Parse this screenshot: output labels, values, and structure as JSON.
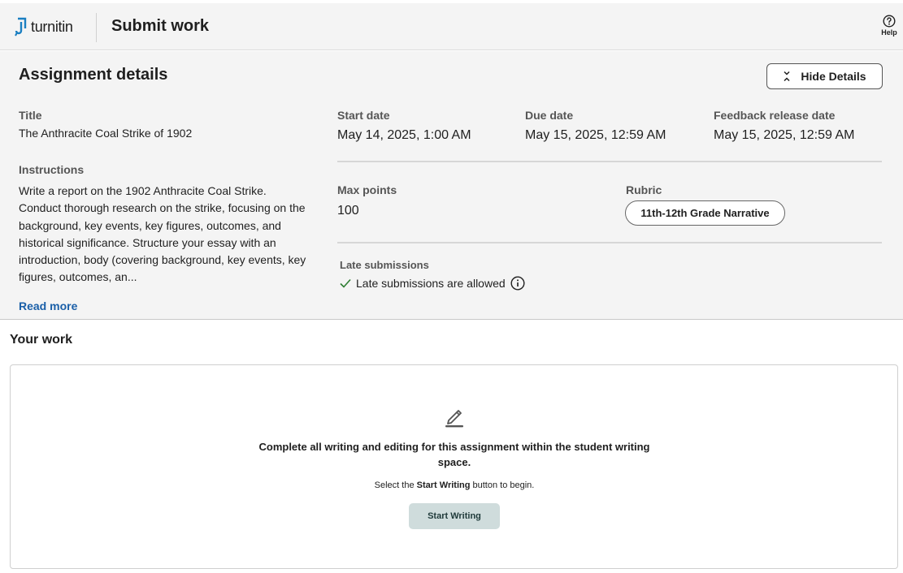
{
  "header": {
    "logo_text": "turnitin",
    "page_title": "Submit work",
    "help_label": "Help"
  },
  "details": {
    "heading": "Assignment details",
    "hide_button_label": "Hide Details",
    "title_label": "Title",
    "title_value": "The Anthracite Coal Strike of 1902",
    "instructions_label": "Instructions",
    "instructions_text": "Write a report on the 1902 Anthracite Coal Strike. Conduct thorough research on the strike, focusing on the background, key events, key figures, outcomes, and historical significance. Structure your essay with an introduction, body (covering background, key events, key figures, outcomes, an...",
    "read_more_label": "Read more",
    "start_date_label": "Start date",
    "start_date_value": "May 14, 2025, 1:00 AM",
    "due_date_label": "Due date",
    "due_date_value": "May 15, 2025, 12:59 AM",
    "feedback_label": "Feedback release date",
    "feedback_value": "May 15, 2025, 12:59 AM",
    "max_points_label": "Max points",
    "max_points_value": "100",
    "rubric_label": "Rubric",
    "rubric_value": "11th-12th Grade Narrative",
    "late_label": "Late submissions",
    "late_value": "Late submissions are allowed"
  },
  "work": {
    "heading": "Your work",
    "message": "Complete all writing and editing for this assignment within the student writing space.",
    "hint_prefix": "Select the ",
    "hint_bold": "Start Writing",
    "hint_suffix": " button to begin.",
    "start_button_label": "Start Writing"
  },
  "colors": {
    "logo_blue": "#1a7fc1",
    "link_blue": "#1a5fa8",
    "check_green": "#2e7d32",
    "start_button_bg": "#cfdcdc"
  }
}
